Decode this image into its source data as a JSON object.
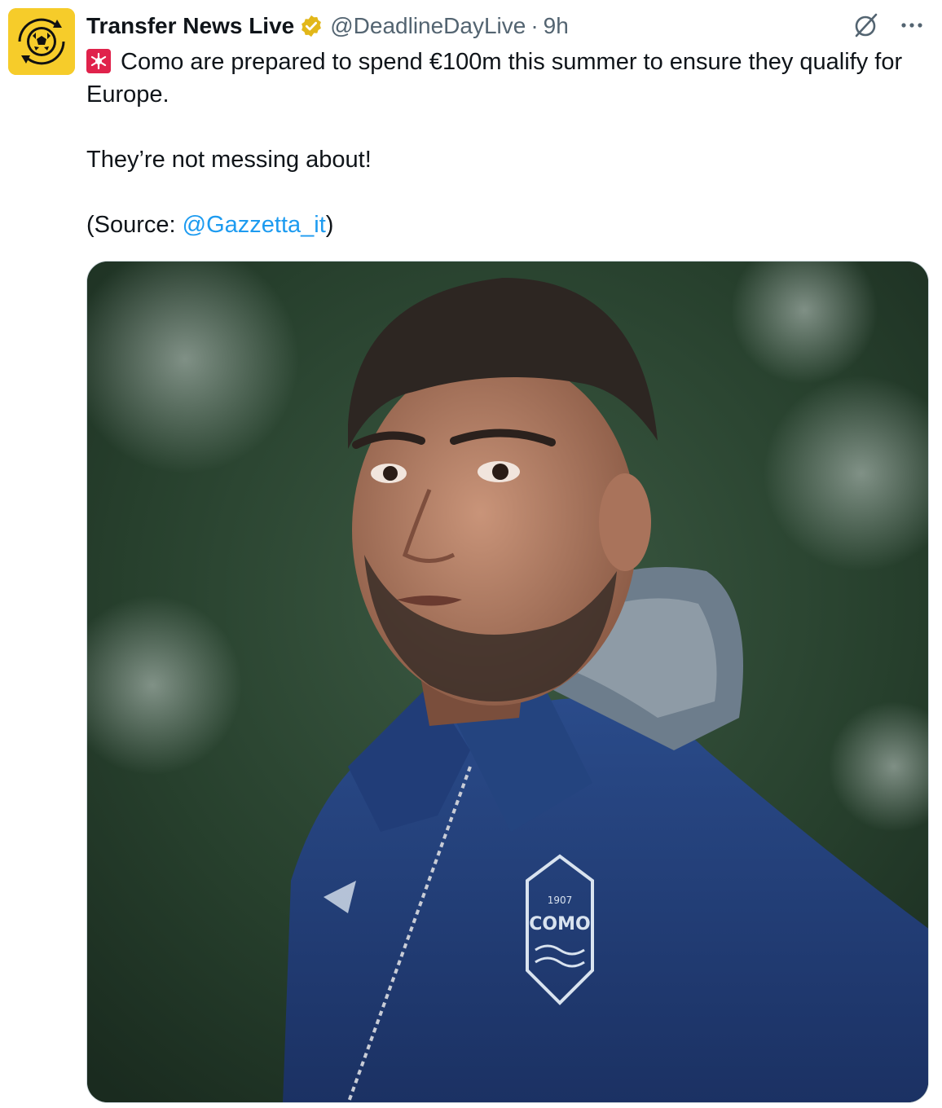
{
  "tweet": {
    "author": {
      "name": "Transfer News Live",
      "handle": "@DeadlineDayLive",
      "verified": true,
      "avatar_icon": "football-logo-icon",
      "avatar_color": "#f6cc2a"
    },
    "separator": "·",
    "time": "9h",
    "actions": {
      "grok_icon": "grok-icon",
      "more_icon": "more-options-icon"
    },
    "text": {
      "line1": "Como are prepared to spend €100m this summer to ensure they qualify for Europe.",
      "line2": "They’re not messing about!",
      "source_prefix": "(Source: ",
      "source_mention": "@Gazzetta_it",
      "source_suffix": ")"
    },
    "emoji": "siren-emoji-icon",
    "media": {
      "badge_year": "1907",
      "badge_name": "COMO"
    },
    "colors": {
      "link": "#1d9bf0",
      "secondary_text": "#536471",
      "verified_gold": "#e2b719"
    }
  }
}
